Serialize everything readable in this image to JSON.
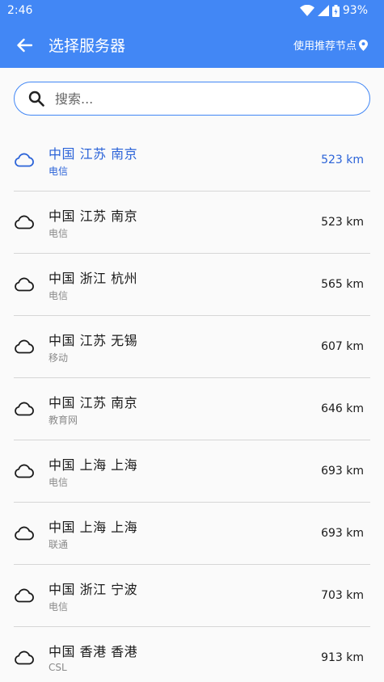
{
  "status_bar": {
    "time": "2:46",
    "battery": "93%"
  },
  "app_bar": {
    "title": "选择服务器",
    "recommend_label": "使用推荐节点"
  },
  "search": {
    "placeholder": "搜索..."
  },
  "colors": {
    "primary": "#4287f5",
    "selected": "#2b63d8"
  },
  "servers": [
    {
      "name": "中国 江苏 南京",
      "isp": "电信",
      "distance": "523 km",
      "selected": true
    },
    {
      "name": "中国 江苏 南京",
      "isp": "电信",
      "distance": "523 km",
      "selected": false
    },
    {
      "name": "中国 浙江 杭州",
      "isp": "电信",
      "distance": "565 km",
      "selected": false
    },
    {
      "name": "中国 江苏 无锡",
      "isp": "移动",
      "distance": "607 km",
      "selected": false
    },
    {
      "name": "中国 江苏 南京",
      "isp": "教育网",
      "distance": "646 km",
      "selected": false
    },
    {
      "name": "中国 上海 上海",
      "isp": "电信",
      "distance": "693 km",
      "selected": false
    },
    {
      "name": "中国 上海 上海",
      "isp": "联通",
      "distance": "693 km",
      "selected": false
    },
    {
      "name": "中国 浙江 宁波",
      "isp": "电信",
      "distance": "703 km",
      "selected": false
    },
    {
      "name": "中国 香港 香港",
      "isp": "CSL",
      "distance": "913 km",
      "selected": false
    }
  ]
}
